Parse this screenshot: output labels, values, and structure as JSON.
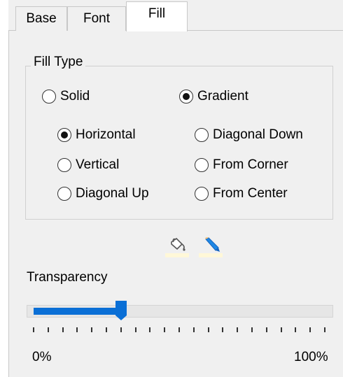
{
  "tabs": [
    {
      "label": "Base",
      "active": false
    },
    {
      "label": "Font",
      "active": false
    },
    {
      "label": "Fill",
      "active": true
    }
  ],
  "fill_type": {
    "title": "Fill Type",
    "main_options": [
      {
        "label": "Solid",
        "selected": false
      },
      {
        "label": "Gradient",
        "selected": true
      }
    ],
    "gradient_options": [
      {
        "label": "Horizontal",
        "selected": true
      },
      {
        "label": "Vertical",
        "selected": false
      },
      {
        "label": "Diagonal Up",
        "selected": false
      },
      {
        "label": "Diagonal Down",
        "selected": false
      },
      {
        "label": "From Corner",
        "selected": false
      },
      {
        "label": "From Center",
        "selected": false
      }
    ]
  },
  "tools": {
    "icons": [
      "paint-bucket-icon",
      "pen-icon"
    ],
    "accent_colors": {
      "bucket": "#555555",
      "pen_body": "#1e88e5",
      "pen_tip": "#f5c27a",
      "swatch": "#fff8d8"
    }
  },
  "transparency": {
    "label": "Transparency",
    "value_percent": 30,
    "min_label": "0%",
    "max_label": "100%",
    "accent": "#0a6fd6"
  }
}
